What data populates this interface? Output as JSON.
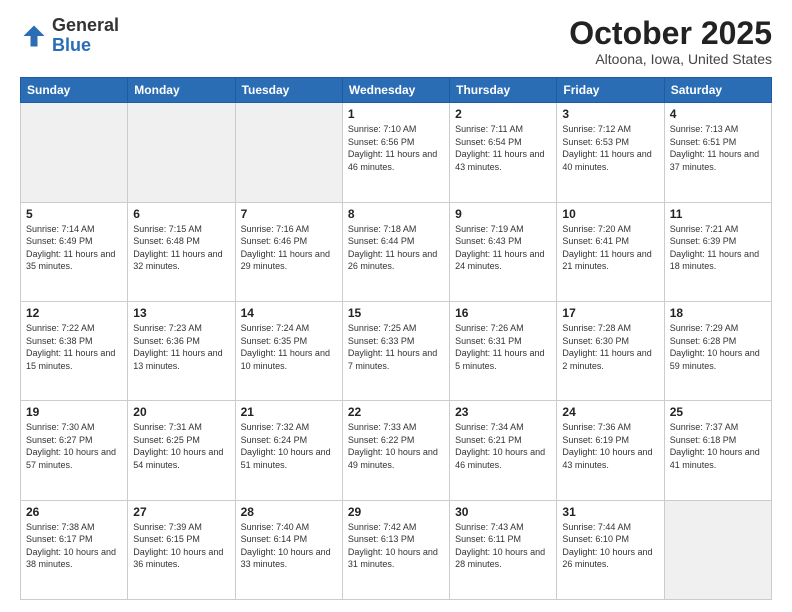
{
  "logo": {
    "general": "General",
    "blue": "Blue"
  },
  "title": "October 2025",
  "subtitle": "Altoona, Iowa, United States",
  "header_days": [
    "Sunday",
    "Monday",
    "Tuesday",
    "Wednesday",
    "Thursday",
    "Friday",
    "Saturday"
  ],
  "weeks": [
    [
      {
        "day": "",
        "info": ""
      },
      {
        "day": "",
        "info": ""
      },
      {
        "day": "",
        "info": ""
      },
      {
        "day": "1",
        "info": "Sunrise: 7:10 AM\nSunset: 6:56 PM\nDaylight: 11 hours and 46 minutes."
      },
      {
        "day": "2",
        "info": "Sunrise: 7:11 AM\nSunset: 6:54 PM\nDaylight: 11 hours and 43 minutes."
      },
      {
        "day": "3",
        "info": "Sunrise: 7:12 AM\nSunset: 6:53 PM\nDaylight: 11 hours and 40 minutes."
      },
      {
        "day": "4",
        "info": "Sunrise: 7:13 AM\nSunset: 6:51 PM\nDaylight: 11 hours and 37 minutes."
      }
    ],
    [
      {
        "day": "5",
        "info": "Sunrise: 7:14 AM\nSunset: 6:49 PM\nDaylight: 11 hours and 35 minutes."
      },
      {
        "day": "6",
        "info": "Sunrise: 7:15 AM\nSunset: 6:48 PM\nDaylight: 11 hours and 32 minutes."
      },
      {
        "day": "7",
        "info": "Sunrise: 7:16 AM\nSunset: 6:46 PM\nDaylight: 11 hours and 29 minutes."
      },
      {
        "day": "8",
        "info": "Sunrise: 7:18 AM\nSunset: 6:44 PM\nDaylight: 11 hours and 26 minutes."
      },
      {
        "day": "9",
        "info": "Sunrise: 7:19 AM\nSunset: 6:43 PM\nDaylight: 11 hours and 24 minutes."
      },
      {
        "day": "10",
        "info": "Sunrise: 7:20 AM\nSunset: 6:41 PM\nDaylight: 11 hours and 21 minutes."
      },
      {
        "day": "11",
        "info": "Sunrise: 7:21 AM\nSunset: 6:39 PM\nDaylight: 11 hours and 18 minutes."
      }
    ],
    [
      {
        "day": "12",
        "info": "Sunrise: 7:22 AM\nSunset: 6:38 PM\nDaylight: 11 hours and 15 minutes."
      },
      {
        "day": "13",
        "info": "Sunrise: 7:23 AM\nSunset: 6:36 PM\nDaylight: 11 hours and 13 minutes."
      },
      {
        "day": "14",
        "info": "Sunrise: 7:24 AM\nSunset: 6:35 PM\nDaylight: 11 hours and 10 minutes."
      },
      {
        "day": "15",
        "info": "Sunrise: 7:25 AM\nSunset: 6:33 PM\nDaylight: 11 hours and 7 minutes."
      },
      {
        "day": "16",
        "info": "Sunrise: 7:26 AM\nSunset: 6:31 PM\nDaylight: 11 hours and 5 minutes."
      },
      {
        "day": "17",
        "info": "Sunrise: 7:28 AM\nSunset: 6:30 PM\nDaylight: 11 hours and 2 minutes."
      },
      {
        "day": "18",
        "info": "Sunrise: 7:29 AM\nSunset: 6:28 PM\nDaylight: 10 hours and 59 minutes."
      }
    ],
    [
      {
        "day": "19",
        "info": "Sunrise: 7:30 AM\nSunset: 6:27 PM\nDaylight: 10 hours and 57 minutes."
      },
      {
        "day": "20",
        "info": "Sunrise: 7:31 AM\nSunset: 6:25 PM\nDaylight: 10 hours and 54 minutes."
      },
      {
        "day": "21",
        "info": "Sunrise: 7:32 AM\nSunset: 6:24 PM\nDaylight: 10 hours and 51 minutes."
      },
      {
        "day": "22",
        "info": "Sunrise: 7:33 AM\nSunset: 6:22 PM\nDaylight: 10 hours and 49 minutes."
      },
      {
        "day": "23",
        "info": "Sunrise: 7:34 AM\nSunset: 6:21 PM\nDaylight: 10 hours and 46 minutes."
      },
      {
        "day": "24",
        "info": "Sunrise: 7:36 AM\nSunset: 6:19 PM\nDaylight: 10 hours and 43 minutes."
      },
      {
        "day": "25",
        "info": "Sunrise: 7:37 AM\nSunset: 6:18 PM\nDaylight: 10 hours and 41 minutes."
      }
    ],
    [
      {
        "day": "26",
        "info": "Sunrise: 7:38 AM\nSunset: 6:17 PM\nDaylight: 10 hours and 38 minutes."
      },
      {
        "day": "27",
        "info": "Sunrise: 7:39 AM\nSunset: 6:15 PM\nDaylight: 10 hours and 36 minutes."
      },
      {
        "day": "28",
        "info": "Sunrise: 7:40 AM\nSunset: 6:14 PM\nDaylight: 10 hours and 33 minutes."
      },
      {
        "day": "29",
        "info": "Sunrise: 7:42 AM\nSunset: 6:13 PM\nDaylight: 10 hours and 31 minutes."
      },
      {
        "day": "30",
        "info": "Sunrise: 7:43 AM\nSunset: 6:11 PM\nDaylight: 10 hours and 28 minutes."
      },
      {
        "day": "31",
        "info": "Sunrise: 7:44 AM\nSunset: 6:10 PM\nDaylight: 10 hours and 26 minutes."
      },
      {
        "day": "",
        "info": ""
      }
    ]
  ]
}
